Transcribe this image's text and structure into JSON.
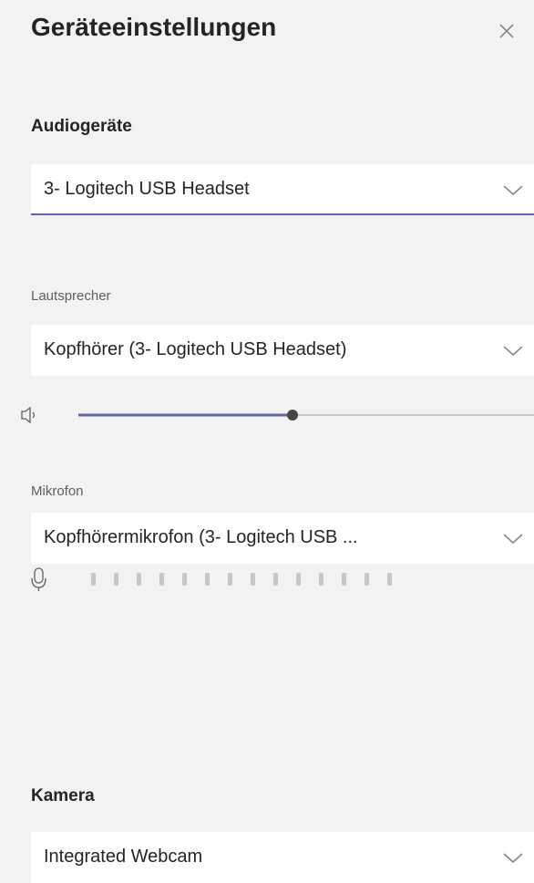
{
  "dialog": {
    "title": "Geräteeinstellungen"
  },
  "audio": {
    "heading": "Audiogeräte",
    "device": "3- Logitech USB Headset"
  },
  "speaker": {
    "label": "Lautsprecher",
    "device": "Kopfhörer (3- Logitech USB Headset)",
    "volume_fraction": 0.47
  },
  "microphone": {
    "label": "Mikrofon",
    "device": "Kopfhörermikrofon (3- Logitech USB ...",
    "level_bar_count": 14
  },
  "camera": {
    "heading": "Kamera",
    "device": "Integrated Webcam"
  },
  "colors": {
    "accent": "#6264a7",
    "background": "#f3f2f1",
    "field": "#ffffff"
  },
  "icons": [
    "close-icon",
    "chevron-down-icon",
    "speaker-icon",
    "microphone-icon"
  ]
}
